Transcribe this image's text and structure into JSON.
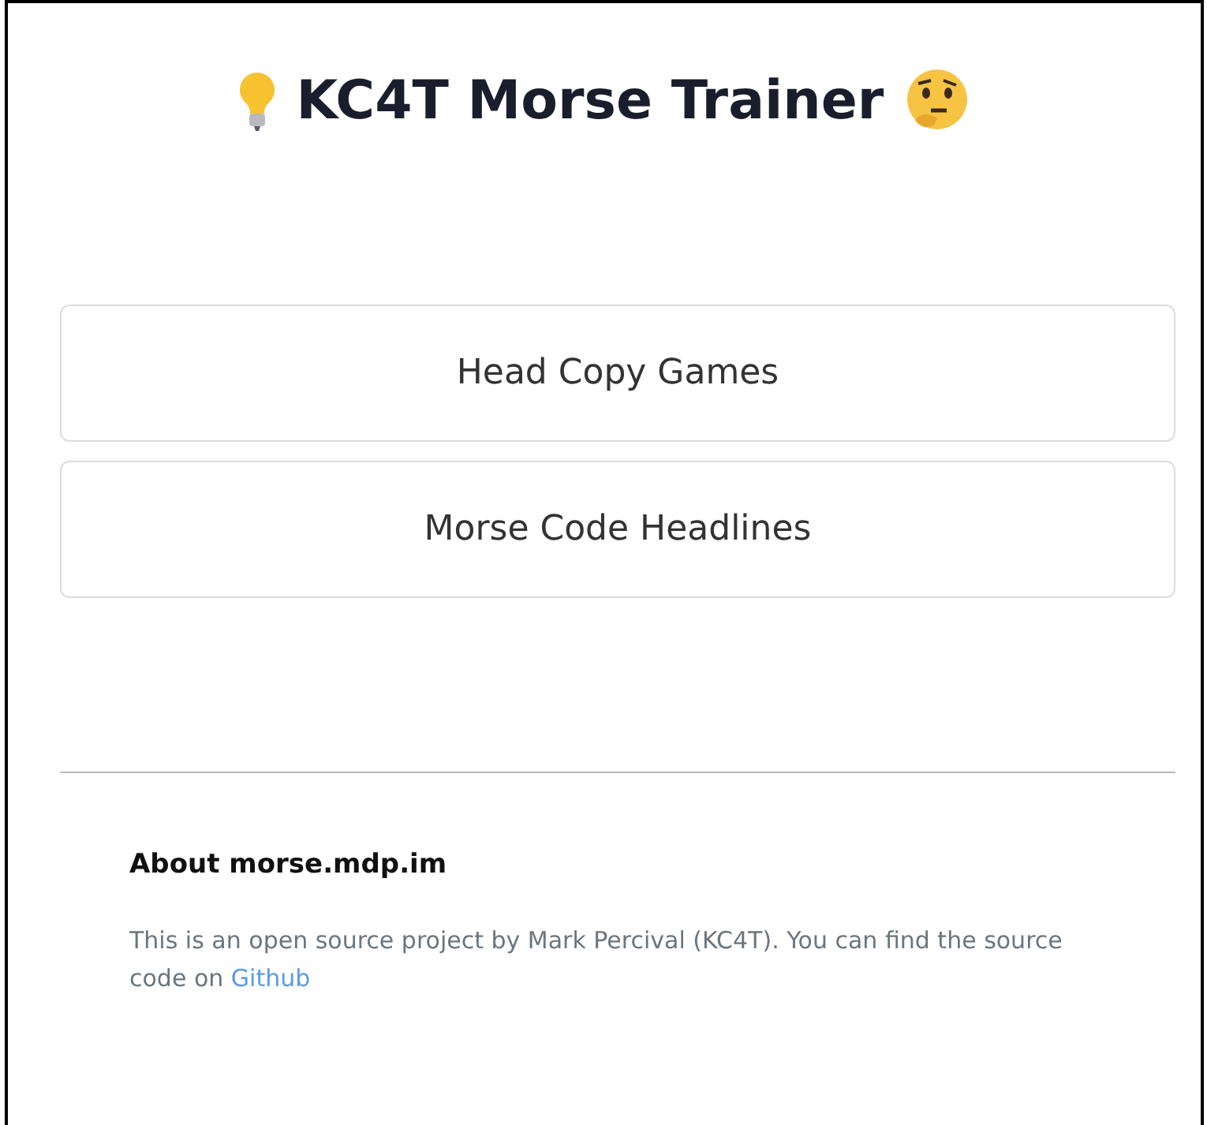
{
  "header": {
    "title": "KC4T Morse Trainer"
  },
  "menu": [
    {
      "label": "Head Copy Games"
    },
    {
      "label": "Morse Code Headlines"
    }
  ],
  "about": {
    "heading": "About morse.mdp.im",
    "text": "This is an open source project by Mark Percival (KC4T). You can find the source code on ",
    "link": "Github"
  }
}
